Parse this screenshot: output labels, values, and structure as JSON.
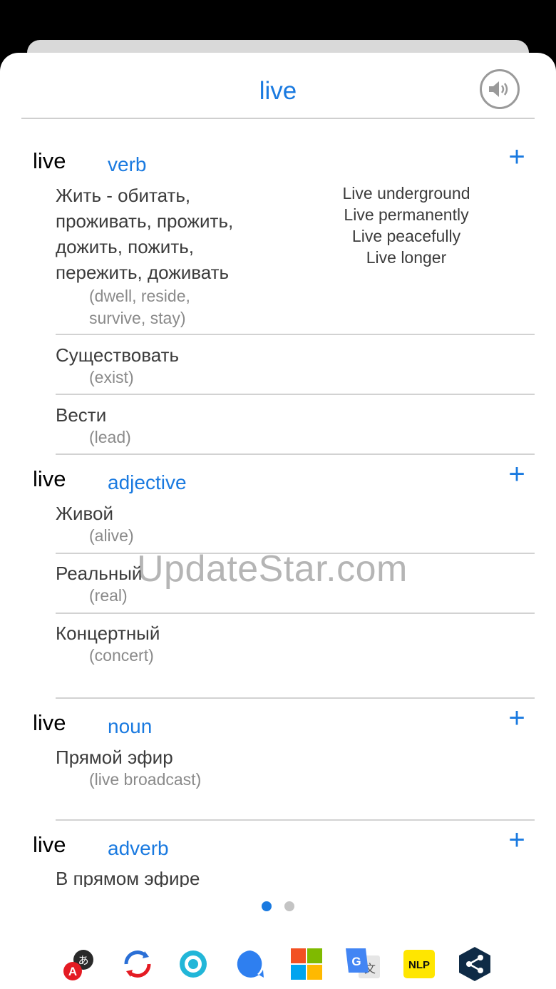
{
  "header": {
    "title": "live"
  },
  "entries": [
    {
      "word": "live",
      "pos": "verb",
      "senses": [
        {
          "lines": [
            "Жить - обитать,",
            "проживать, прожить,",
            "дожить, пожить,",
            "пережить, доживать"
          ],
          "gloss_lines": [
            "(dwell, reside,",
            "survive, stay)"
          ]
        },
        {
          "lines": [
            "Существовать"
          ],
          "gloss_lines": [
            "(exist)"
          ]
        },
        {
          "lines": [
            "Вести"
          ],
          "gloss_lines": [
            "(lead)"
          ]
        }
      ],
      "examples": [
        "Live underground",
        "Live permanently",
        "Live peacefully",
        "Live longer"
      ]
    },
    {
      "word": "live",
      "pos": "adjective",
      "senses": [
        {
          "lines": [
            "Живой"
          ],
          "gloss_lines": [
            "(alive)"
          ]
        },
        {
          "lines": [
            "Реальный"
          ],
          "gloss_lines": [
            "(real)"
          ]
        },
        {
          "lines": [
            "Концертный"
          ],
          "gloss_lines": [
            "(concert)"
          ]
        }
      ]
    },
    {
      "word": "live",
      "pos": "noun",
      "senses": [
        {
          "lines": [
            "Прямой эфир"
          ],
          "gloss_lines": [
            "(live broadcast)"
          ]
        }
      ]
    },
    {
      "word": "live",
      "pos": "adverb",
      "senses": [
        {
          "lines": [
            "В прямом эфире"
          ],
          "gloss_lines": []
        }
      ]
    }
  ],
  "watermark": "UpdateStar.com",
  "pager": {
    "pages": 2,
    "current": 1
  },
  "dock": {
    "apps": [
      {
        "icon": "translator-a-icon"
      },
      {
        "icon": "sync-translate-icon"
      },
      {
        "icon": "ring-app-icon"
      },
      {
        "icon": "chat-bubble-icon"
      },
      {
        "icon": "microsoft-icon"
      },
      {
        "icon": "google-translate-icon"
      },
      {
        "icon": "nlp-icon",
        "label": "NLP"
      },
      {
        "icon": "share-hex-icon"
      }
    ]
  },
  "colors": {
    "accent": "#1a7ae0",
    "text": "#3c3c3c",
    "gloss": "#8a8a8a"
  }
}
